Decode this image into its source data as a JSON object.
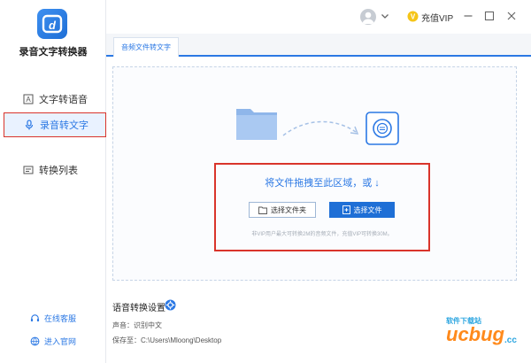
{
  "app": {
    "title": "录音文字转换器"
  },
  "sidebar": {
    "items": [
      {
        "label": "文字转语音"
      },
      {
        "label": "录音转文字"
      },
      {
        "label": "转换列表"
      }
    ],
    "footer": {
      "service": "在线客服",
      "group": "进入官网"
    }
  },
  "topbar": {
    "vip_label": "充值VIP"
  },
  "tab": {
    "active_label": "音频文件转文字"
  },
  "dropzone": {
    "hint": "将文件拖拽至此区域，或  ↓",
    "select_folder": "选择文件夹",
    "select_file": "选择文件",
    "size_note": "非VIP用户最大可转换2M的音频文件，充值VIP可转换30M。"
  },
  "settings": {
    "title": "语音转换设置",
    "voice_label": "声音：",
    "voice_value": "识别中文",
    "save_label": "保存至：",
    "save_value": "C:\\Users\\Mloong\\Desktop"
  },
  "watermark": {
    "main": "ucbug",
    "sub": "软件下载站",
    "cc": ".cc"
  },
  "colors": {
    "accent": "#2b78e4",
    "highlight": "#d9342b",
    "vip": "#f5c518"
  }
}
